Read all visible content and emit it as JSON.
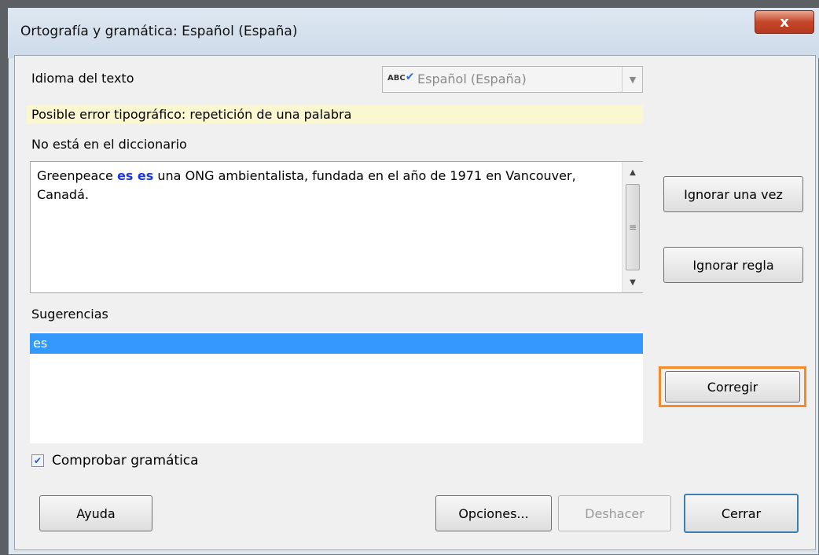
{
  "window": {
    "title": "Ortografía y gramática: Español (España)",
    "close_glyph": "x"
  },
  "language": {
    "label": "Idioma del texto",
    "selected": "Español (España)",
    "icon_text": "ABC"
  },
  "hint": "Posible error tipográfico: repetición de una palabra",
  "dictionary": {
    "label": "No está en el diccionario",
    "text_before": "Greenpeace ",
    "text_highlight": "es es",
    "text_after": " una ONG ambientalista, fundada en  el año de 1971 en Vancouver, Canadá."
  },
  "suggestions": {
    "label": "Sugerencias",
    "items": [
      "es"
    ]
  },
  "grammar_check": {
    "label": "Comprobar gramática",
    "checked": true
  },
  "buttons": {
    "ignore_once": "Ignorar una vez",
    "ignore_rule": "Ignorar regla",
    "correct": "Corregir",
    "help": "Ayuda",
    "options": "Opciones...",
    "undo": "Deshacer",
    "close": "Cerrar"
  },
  "colors": {
    "selection": "#3399ff",
    "hint_background": "#fbf7d0",
    "focus_ring": "#f28c28",
    "highlight_text": "#1d37d8"
  }
}
